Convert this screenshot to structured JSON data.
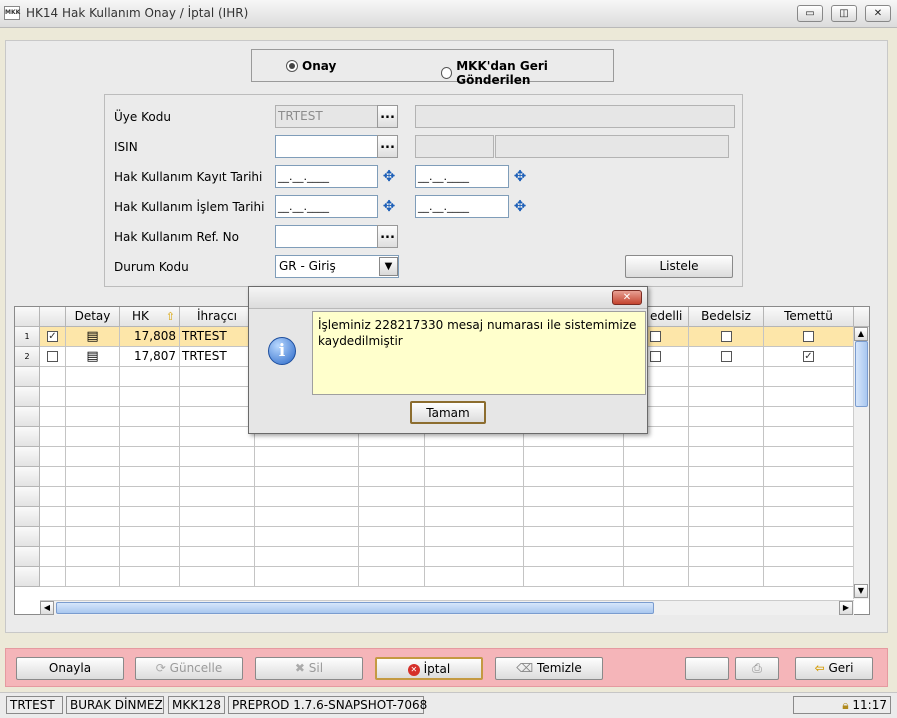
{
  "window": {
    "title": "HK14 Hak Kullanım Onay / İptal (IHR)",
    "logo_text": "MKK",
    "minimize": "▭",
    "restore": "◫",
    "close": "✕"
  },
  "radio": {
    "option1": "Onay",
    "option2": "MKK'dan Geri Gönderilen",
    "selected": "Onay"
  },
  "form": {
    "uye_kodu_label": "Üye Kodu",
    "uye_kodu_value": "TRTEST",
    "isin_label": "ISIN",
    "kayit_tarihi_label": "Hak Kullanım Kayıt Tarihi",
    "islem_tarihi_label": "Hak Kullanım İşlem Tarihi",
    "ref_no_label": "Hak Kullanım Ref. No",
    "durum_kodu_label": "Durum Kodu",
    "durum_kodu_value": "GR - Giriş",
    "date_mask": "__.__.____",
    "dots": "...",
    "listele_label": "Listele"
  },
  "grid": {
    "headers": [
      "Detay",
      "HK",
      "İhraçcı",
      "edelli",
      "Bedelsiz",
      "Temettü"
    ],
    "rows": [
      {
        "num": "1",
        "checked": true,
        "hk": "17,808",
        "ihracci": "TRTEST",
        "bedelli": false,
        "bedelsiz": false,
        "temettu": false
      },
      {
        "num": "2",
        "checked": false,
        "hk": "17,807",
        "ihracci": "TRTEST",
        "bedelli": false,
        "bedelsiz": false,
        "temettu": true
      }
    ]
  },
  "dialog": {
    "message": "İşleminiz 228217330 mesaj numarası ile sistemimize kaydedilmiştir",
    "ok_label": "Tamam",
    "close": "✕",
    "icon": "i"
  },
  "toolbar": {
    "onayla": "Onayla",
    "guncelle": "Güncelle",
    "sil": "Sil",
    "iptal": "İptal",
    "temizle": "Temizle",
    "geri": "Geri"
  },
  "status": {
    "user_code": "TRTEST",
    "user_name": "BURAK DİNMEZ",
    "member": "MKK128",
    "version": "PREPROD 1.7.6-SNAPSHOT-7068",
    "time": "11:17"
  },
  "colors": {
    "bottom_bar": "#f5b5b9",
    "selected_row": "#fde6a9",
    "message_bg": "#ffffcc"
  }
}
